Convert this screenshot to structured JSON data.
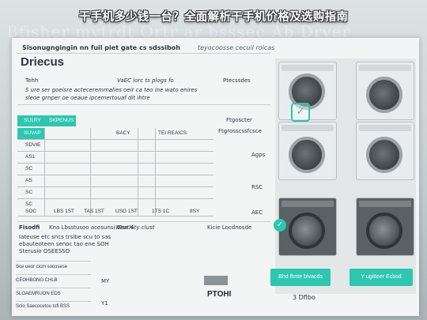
{
  "banner": {
    "title": "干手机多少钱一台？全面解析干手机价格及选购指南"
  },
  "ghost": {
    "title": "Bfisher mvtrdt Ortr ar bsssec Ab Dryer"
  },
  "doc": {
    "topline_left": "Sisonugngingin nn fuil piet gate cs sdssiboh",
    "topline_right": "teyocoosse cecuil roicas",
    "heading": "Driecus",
    "row1_left": "Tehh",
    "row1_mid": "VaEC iorc ts plogs fo",
    "row1_right": "Ptecssdes",
    "row2": "S ure ser goeisre acteceremmalies oeir ca teo ine wato enires",
    "row3": "sleoe grnper oe oeaue ipcemertouaf dit ihtre",
    "table_header": [
      "SU1RY",
      "SKPENUS"
    ],
    "table_col_heads": [
      "SUVAP",
      "BACY",
      "TEI REAICS"
    ],
    "table_left_labels": [
      "SDVIE",
      "AS1",
      "SC",
      "AS",
      "SC",
      "SC"
    ],
    "table_footer": [
      "SOC",
      "LBS 1ST",
      "TAS 1ST",
      "USG 1ST",
      "1TS 1C",
      "8SY"
    ],
    "right_notes": [
      "Ftgoscter",
      "Ftgrosscssfcsce",
      "Agps",
      "RSC",
      "AEC"
    ],
    "section2_left": "Fisodfi",
    "section2_mid": "Kna Lbsstusoo acesunsi Wse.4",
    "section2_mid2": "Wasthity clust",
    "section2_right": "Kicie Locdnosde",
    "section2_lines": [
      "Iateuse etc sncs trsibe scu to sas",
      "ebauteoteen senoc tao ene SOH",
      "Sterusio OSEESSO"
    ],
    "bottom_rows": [
      "Sce ueor cicm socosese",
      "CEOHBONG CHLB",
      "SLOAEMRUON EDS",
      "Sclo Saecocetou tsfl BSS"
    ],
    "bottom_mid": [
      "MY",
      "Y1"
    ],
    "ptohi": "PTOHI",
    "btn1": "Bhd fhrite bivacds",
    "btn2": "Y ugitteer Ecbsd",
    "btn3_line": "3 Dflbo"
  }
}
